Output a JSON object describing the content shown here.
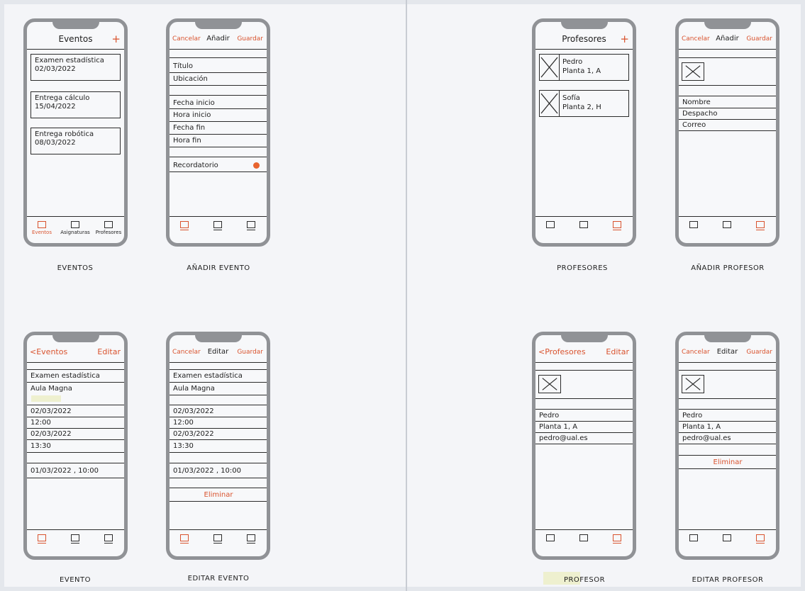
{
  "colors": {
    "accent": "#d9532e",
    "frame": "#909296",
    "ink": "#1d1d1d",
    "paper": "#f4f5f8"
  },
  "tabs": {
    "eventos": "Eventos",
    "asignaturas": "Asignaturas",
    "profesores": "Profesores"
  },
  "phones": {
    "eventos": {
      "title": "Eventos",
      "add": "+",
      "items": [
        {
          "name": "Examen estadística",
          "date": "02/03/2022"
        },
        {
          "name": "Entrega cálculo",
          "date": "15/04/2022"
        },
        {
          "name": "Entrega robótica",
          "date": "08/03/2022"
        }
      ],
      "caption": "EVENTOS"
    },
    "anadir_evento": {
      "cancel": "Cancelar",
      "title": "Añadir",
      "save": "Guardar",
      "fields": [
        "Título",
        "Ubicación",
        "Fecha inicio",
        "Hora inicio",
        "Fecha fin",
        "Hora fin"
      ],
      "reminder": "Recordatorio",
      "caption": "AÑADIR EVENTO"
    },
    "evento": {
      "back": "<Eventos",
      "edit": "Editar",
      "name": "Examen estadística",
      "location": "Aula Magna",
      "start_date": "02/03/2022",
      "start_time": "12:00",
      "end_date": "02/03/2022",
      "end_time": "13:30",
      "reminder": "01/03/2022 , 10:00",
      "caption": "EVENTO"
    },
    "editar_evento": {
      "cancel": "Cancelar",
      "title": "Editar",
      "save": "Guardar",
      "name": "Examen estadística",
      "location": "Aula Magna",
      "start_date": "02/03/2022",
      "start_time": "12:00",
      "end_date": "02/03/2022",
      "end_time": "13:30",
      "reminder": "01/03/2022 , 10:00",
      "delete": "Eliminar",
      "caption": "EDITAR EVENTO"
    },
    "profesores": {
      "title": "Profesores",
      "add": "+",
      "items": [
        {
          "name": "Pedro",
          "office": "Planta 1, A"
        },
        {
          "name": "Sofía",
          "office": "Planta 2, H"
        }
      ],
      "caption": "PROFESORES"
    },
    "anadir_profesor": {
      "cancel": "Cancelar",
      "title": "Añadir",
      "save": "Guardar",
      "fields": [
        "Nombre",
        "Despacho",
        "Correo"
      ],
      "caption": "AÑADIR PROFESOR"
    },
    "profesor": {
      "back": "<Profesores",
      "edit": "Editar",
      "name": "Pedro",
      "office": "Planta 1, A",
      "email": "pedro@ual.es",
      "caption": "PROFESOR"
    },
    "editar_profesor": {
      "cancel": "Cancelar",
      "title": "Editar",
      "save": "Guardar",
      "name": "Pedro",
      "office": "Planta 1, A",
      "email": "pedro@ual.es",
      "delete": "Eliminar",
      "caption": "EDITAR PROFESOR"
    }
  }
}
